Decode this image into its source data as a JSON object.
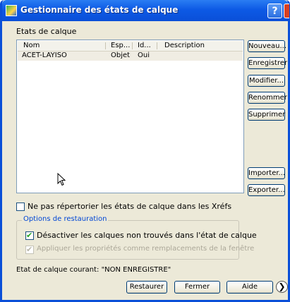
{
  "window": {
    "title": "Gestionnaire des états de calque",
    "help_label": "?"
  },
  "section_label": "Etats de calque",
  "list": {
    "columns": [
      "Nom",
      "Esp...",
      "Id...",
      "Description"
    ],
    "rows": [
      {
        "name": "ACET-LAYISO",
        "space": "Objet",
        "id": "Oui",
        "description": ""
      }
    ]
  },
  "buttons": {
    "new": "Nouveau...",
    "save": "Enregistrer",
    "modify": "Modifier...",
    "rename": "Renommer",
    "delete": "Supprimer",
    "import": "Importer...",
    "export": "Exporter...",
    "restore": "Restaurer",
    "close": "Fermer",
    "help": "Aide"
  },
  "options": {
    "no_xref": {
      "label": "Ne pas répertorier les états de calque dans les Xréfs",
      "checked": false
    },
    "group_title": "Options de restauration",
    "disable_layers": {
      "label": "Désactiver les calques non trouvés dans l'état de calque",
      "checked": true
    },
    "apply_props": {
      "label": "Appliquer les propriétés comme remplacements de la fenêtre",
      "checked": true,
      "disabled": true
    }
  },
  "current_state": "Etat de calque courant: \"NON ENREGISTRE\"",
  "nav_glyph": "❯"
}
